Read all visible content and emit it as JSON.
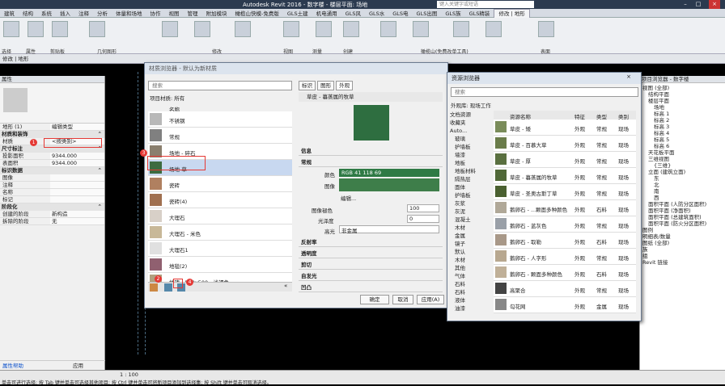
{
  "window": {
    "title": "Autodesk Revit 2016 -   数字楼 - 楼层平面: 场地",
    "search_placeholder": "键入关键字或短语"
  },
  "tabs": [
    "建筑",
    "结构",
    "系统",
    "插入",
    "注释",
    "分析",
    "体量和场地",
    "协作",
    "视图",
    "管理",
    "附加模块",
    "橄榄山快模-免费版",
    "GLS土建",
    "机电通用",
    "GLS风",
    "GLS水",
    "GLS电",
    "GLS出图",
    "GLS族",
    "GLS精装",
    "修改 | 地形"
  ],
  "ribbon": {
    "groups": [
      "选择",
      "属性",
      "剪贴板",
      "几何图形",
      "修改",
      "视图",
      "测量",
      "创建",
      "橄榄山(免费改单工具)",
      "表面"
    ]
  },
  "context_bar": "修改 | 地形",
  "properties": {
    "title": "属性",
    "type_selector": "地形 (1)",
    "edit_type": "编辑类型",
    "sections": [
      {
        "name": "材质和装饰",
        "rows": [
          {
            "k": "材质",
            "v": "<按类别>"
          }
        ]
      },
      {
        "name": "尺寸标注",
        "rows": [
          {
            "k": "投影面积",
            "v": "9344.000"
          },
          {
            "k": "表面积",
            "v": "9344.000"
          }
        ]
      },
      {
        "name": "标识数据",
        "rows": [
          {
            "k": "图像",
            "v": ""
          },
          {
            "k": "注释",
            "v": ""
          },
          {
            "k": "名称",
            "v": ""
          },
          {
            "k": "标记",
            "v": ""
          }
        ]
      },
      {
        "name": "阶段化",
        "rows": [
          {
            "k": "创建的阶段",
            "v": "新构造"
          },
          {
            "k": "拆除的阶段",
            "v": "无"
          }
        ]
      }
    ],
    "help_link": "属性帮助",
    "apply": "应用"
  },
  "matdlg": {
    "title": "材质浏览器 - 默认为新材质",
    "search_placeholder": "搜索",
    "project_label": "项目材质: 所有",
    "column": "名称",
    "materials": [
      {
        "name": "不锈钢",
        "color": "#b8b8b8"
      },
      {
        "name": "常规",
        "color": "#808080"
      },
      {
        "name": "场地 - 碎石",
        "color": "#8a7f6e"
      },
      {
        "name": "场地-草",
        "color": "#3d6b40"
      },
      {
        "name": "瓷砖",
        "color": "#b08060"
      },
      {
        "name": "瓷砖(4)",
        "color": "#a07050"
      },
      {
        "name": "大理石",
        "color": "#d8d0c8"
      },
      {
        "name": "大理石 - 米色",
        "color": "#c8b898"
      },
      {
        "name": "大理石1",
        "color": "#e0e0e0"
      },
      {
        "name": "地毯(2)",
        "color": "#906070"
      },
      {
        "name": "地砖 - 500x500，浅褐色",
        "color": "#b0a080"
      }
    ],
    "tabs": [
      "标识",
      "图形",
      "外观"
    ],
    "asset_name": "草皮 - 暮蒸属的牧草",
    "info": "信息",
    "general": "常规",
    "fields": [
      {
        "k": "颜色",
        "v": "RGB 41 118 69"
      },
      {
        "k": "图像",
        "v": "编辑..."
      },
      {
        "k": "图像褪色",
        "v": "100"
      },
      {
        "k": "光泽度",
        "v": "0"
      },
      {
        "k": "高光",
        "v": "非金属"
      }
    ],
    "sections": [
      "反射率",
      "透明度",
      "剪切",
      "自发光",
      "凹凸"
    ],
    "buttons": [
      "确定",
      "取消",
      "应用(A)"
    ]
  },
  "assdlg": {
    "title": "资源浏览器",
    "search_placeholder": "搜索",
    "library_label": "外观库: 现场工作",
    "tree": [
      "文档资源",
      "收藏夹",
      "Auto...",
      "玻璃",
      "护墙板",
      "墙漆",
      "地板",
      "地板材料",
      "隔热层",
      "面体",
      "护墙板",
      "灰浆",
      "灰泥",
      "混凝土",
      "木材",
      "金属",
      "镜子",
      "默认",
      "木材",
      "其他",
      "气体",
      "石料",
      "石料",
      "液体",
      "油漆"
    ],
    "cols": [
      "资源名称",
      "特征",
      "类型",
      "类别"
    ],
    "rows": [
      {
        "n": "草皮 - 矮",
        "f": "外观",
        "t": "常规",
        "c": "现场",
        "color": "#7a8c5a"
      },
      {
        "n": "草皮 - 百慕大草",
        "f": "外观",
        "t": "常规",
        "c": "现场",
        "color": "#6a7c4a"
      },
      {
        "n": "草皮 - 厚",
        "f": "外观",
        "t": "常规",
        "c": "现场",
        "color": "#5a7040"
      },
      {
        "n": "草皮 - 暮蒸属的牧草",
        "f": "外观",
        "t": "常规",
        "c": "现场",
        "color": "#506838"
      },
      {
        "n": "草皮 - 圣奥古斯丁草",
        "f": "外观",
        "t": "常规",
        "c": "现场",
        "color": "#4a6030"
      },
      {
        "n": "鹅卵石 - ...颗面多种颜色",
        "f": "外观",
        "t": "石料",
        "c": "现场",
        "color": "#b0a898"
      },
      {
        "n": "鹅卵石 - 蓝灰色",
        "f": "外观",
        "t": "常规",
        "c": "现场",
        "color": "#9aa0a8"
      },
      {
        "n": "鹅卵石 - 取勒",
        "f": "外观",
        "t": "石料",
        "c": "现场",
        "color": "#a89888"
      },
      {
        "n": "鹅卵石 - 人字形",
        "f": "外观",
        "t": "常规",
        "c": "现场",
        "color": "#b8a890"
      },
      {
        "n": "鹅卵石 - 颗面多种颜色",
        "f": "外观",
        "t": "石料",
        "c": "现场",
        "color": "#c0b098"
      },
      {
        "n": "高聚合",
        "f": "外观",
        "t": "常规",
        "c": "现场",
        "color": "#444"
      },
      {
        "n": "勾花网",
        "f": "外观",
        "t": "金属",
        "c": "现场",
        "color": "#888"
      }
    ]
  },
  "project_browser": {
    "title": "项目浏览器 - 数字楼",
    "items": [
      "视图 (全部)",
      "结构平面",
      "楼层平面",
      "场地",
      "标高 1",
      "标高 2",
      "标高 3",
      "标高 4",
      "标高 5",
      "标高 6",
      "天花板平面",
      "三维视图",
      "{三维}",
      "立面 (建筑立面)",
      "东",
      "北",
      "南",
      "西",
      "面积平面 (人防分区面积)",
      "面积平面 (净面积)",
      "面积平面 (总建筑面积)",
      "面积平面 (防火分区面积)",
      "图例",
      "明细表/数量",
      "图纸 (全部)",
      "族",
      "组",
      "Revit 链接"
    ]
  },
  "status": {
    "scale": "1 : 100",
    "hint": "单击可进行选择; 按 Tab 键并单击可选择其他项目; 按 Ctrl 键并单击可将新项目添加到选择集; 按 Shift 键并单击可取消选择。"
  },
  "callouts": [
    "1",
    "2",
    "3",
    "4"
  ]
}
